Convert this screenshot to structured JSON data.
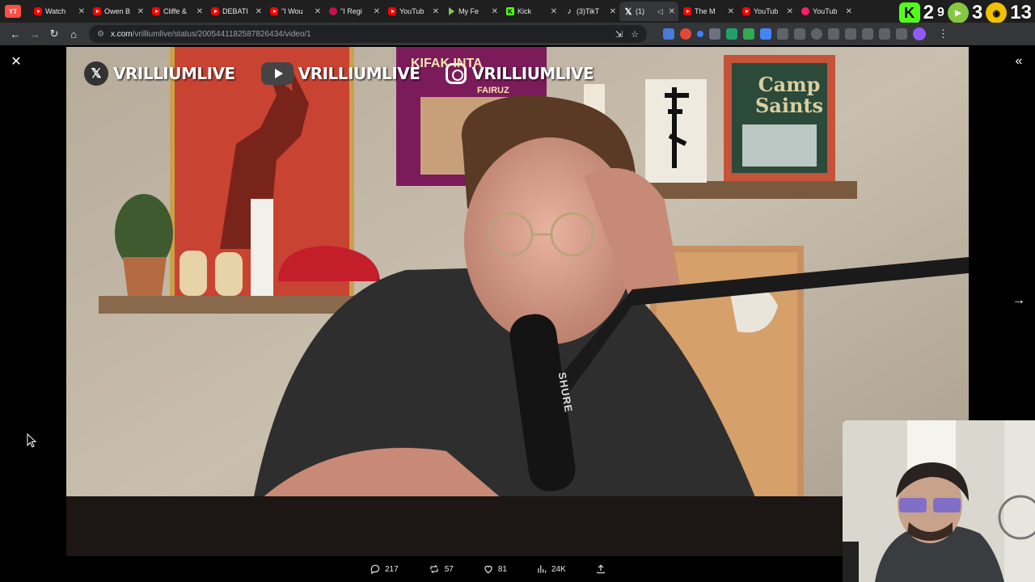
{
  "browser": {
    "app_badge": "YT",
    "tabs": [
      {
        "title": "Watch",
        "favicon": "youtube-icon",
        "active": false
      },
      {
        "title": "Owen B",
        "favicon": "youtube-icon",
        "active": false
      },
      {
        "title": "Cliffe &",
        "favicon": "youtube-icon",
        "active": false
      },
      {
        "title": "DEBATI",
        "favicon": "youtube-icon",
        "active": false
      },
      {
        "title": "\"I Wou",
        "favicon": "youtube-icon",
        "active": false
      },
      {
        "title": "\"I Regi",
        "favicon": "reddit-icon",
        "active": false
      },
      {
        "title": "YouTub",
        "favicon": "youtube-icon",
        "active": false
      },
      {
        "title": "My Fe",
        "favicon": "rumble-icon",
        "active": false
      },
      {
        "title": "Kick",
        "favicon": "kick-icon",
        "active": false
      },
      {
        "title": "(3)TikT",
        "favicon": "tiktok-icon",
        "active": false
      },
      {
        "title": "(1)",
        "favicon": "x-icon",
        "active": true
      },
      {
        "title": "The M",
        "favicon": "youtube-icon",
        "active": false
      },
      {
        "title": "YouTub",
        "favicon": "youtube-icon",
        "active": false
      },
      {
        "title": "YouTub",
        "favicon": "spotify-icon",
        "active": false
      }
    ],
    "overlay_counts": {
      "kick": "2",
      "rumble_badge": "9",
      "rumble": "3",
      "mask": "13"
    },
    "url_host": "x.com",
    "url_path": "/vrilliumlive/status/2005441182587826434/video/1"
  },
  "video": {
    "handles": [
      {
        "platform": "x",
        "name": "VRILLIUMLIVE"
      },
      {
        "platform": "youtube",
        "name": "VRILLIUMLIVE"
      },
      {
        "platform": "instagram",
        "name": "VRILLIUMLIVE"
      }
    ],
    "poster_text": "KIFAK INTA",
    "poster_text_2": "FAIRUZ",
    "book_title": "Camp Saints",
    "mic_brand": "SHURE"
  },
  "actions": {
    "replies": "217",
    "reposts": "57",
    "likes": "81",
    "views": "24K"
  },
  "colors": {
    "accent": "#e7e9ea",
    "background": "#000000",
    "tab_active": "#35363a"
  }
}
